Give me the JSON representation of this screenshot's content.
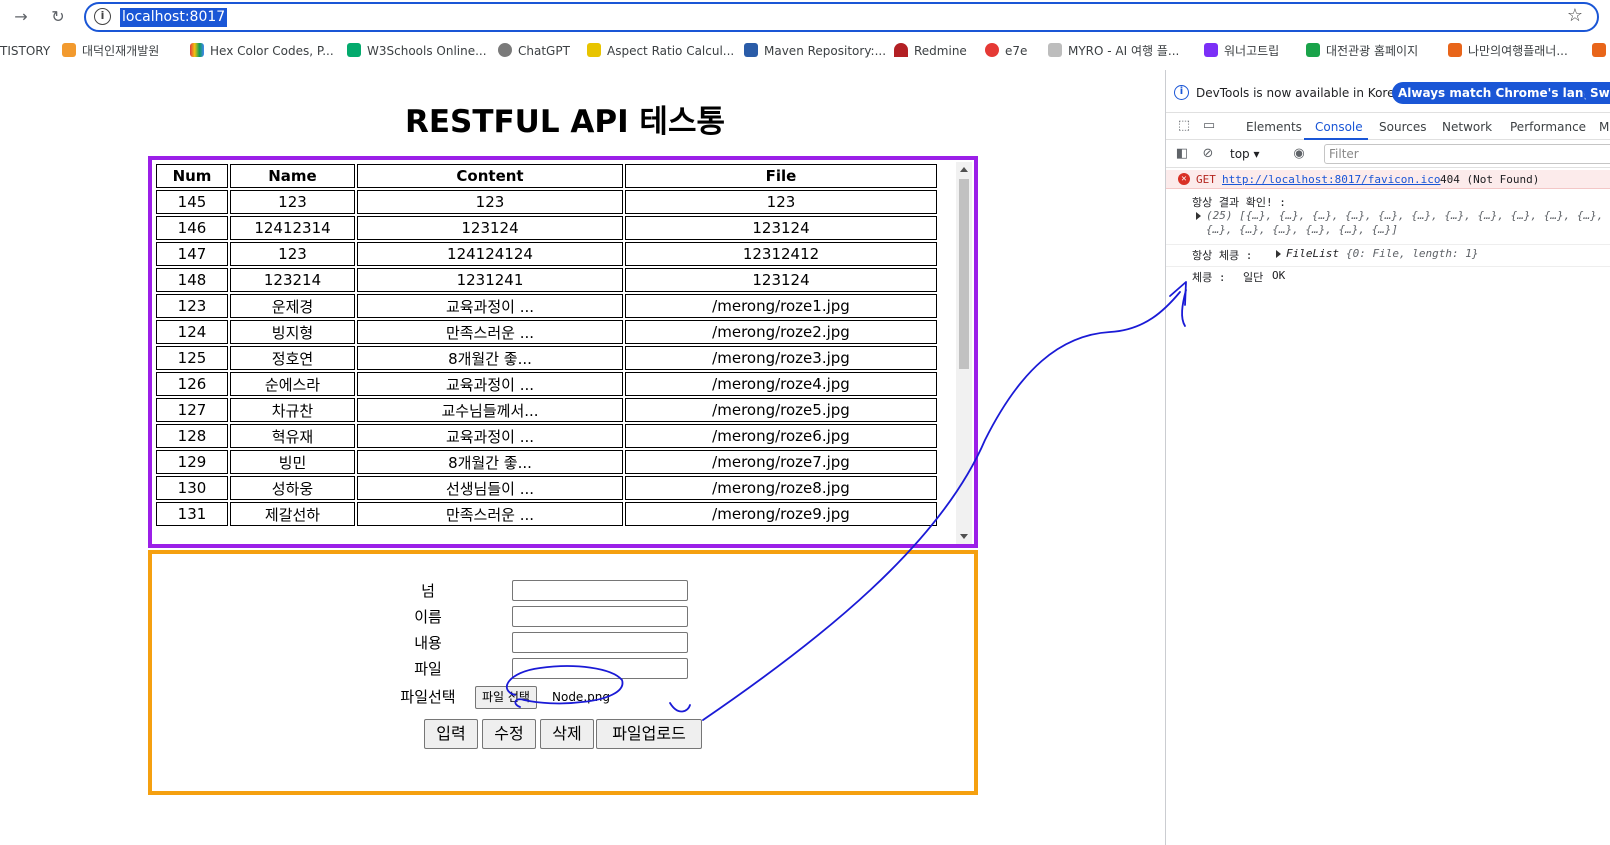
{
  "browser": {
    "url": "localhost:8017",
    "bookmarks": [
      {
        "label": "TISTORY",
        "color": "#000000"
      },
      {
        "label": "대덕인재개발원",
        "color": "#f29a2e"
      },
      {
        "label": "Hex Color Codes, P...",
        "color": "#e03a3e"
      },
      {
        "label": "W3Schools Online...",
        "color": "#04aa6d"
      },
      {
        "label": "ChatGPT",
        "color": "#7a7a7a"
      },
      {
        "label": "Aspect Ratio Calcul...",
        "color": "#e8c400"
      },
      {
        "label": "Maven Repository:...",
        "color": "#2a5ca8"
      },
      {
        "label": "Redmine",
        "color": "#b32024"
      },
      {
        "label": "e7e",
        "color": "#e53935"
      },
      {
        "label": "MYRO - AI 여행 플...",
        "color": "#bdbdbd"
      },
      {
        "label": "워너고트립",
        "color": "#7b2ff7"
      },
      {
        "label": "대전관광 홈페이지",
        "color": "#1aa34a"
      },
      {
        "label": "나만의여행플래너...",
        "color": "#e8651a"
      }
    ]
  },
  "page": {
    "title": "RESTFUL API 테스통",
    "table": {
      "headers": [
        "Num",
        "Name",
        "Content",
        "File"
      ],
      "rows": [
        [
          "145",
          "123",
          "123",
          "123"
        ],
        [
          "146",
          "12412314",
          "123124",
          "123124"
        ],
        [
          "147",
          "123",
          "124124124",
          "12312412"
        ],
        [
          "148",
          "123214",
          "1231241",
          "123124"
        ],
        [
          "123",
          "운제경",
          "교육과정이 ...",
          "/merong/roze1.jpg"
        ],
        [
          "124",
          "빙지형",
          "만족스러운 ...",
          "/merong/roze2.jpg"
        ],
        [
          "125",
          "정호연",
          "8개월간 좋...",
          "/merong/roze3.jpg"
        ],
        [
          "126",
          "순에스라",
          "교육과정이 ...",
          "/merong/roze4.jpg"
        ],
        [
          "127",
          "차규찬",
          "교수님들께서...",
          "/merong/roze5.jpg"
        ],
        [
          "128",
          "혁유재",
          "교육과정이 ...",
          "/merong/roze6.jpg"
        ],
        [
          "129",
          "빙민",
          "8개월간 좋...",
          "/merong/roze7.jpg"
        ],
        [
          "130",
          "성하웅",
          "선생님들이 ...",
          "/merong/roze8.jpg"
        ],
        [
          "131",
          "제갈선하",
          "만족스러운 ...",
          "/merong/roze9.jpg"
        ]
      ]
    },
    "form": {
      "labels": {
        "num": "넘",
        "name": "이름",
        "content": "내용",
        "file": "파일",
        "file_select": "파일선택"
      },
      "file_button": "파일 선택",
      "chosen_file": "Node.png",
      "buttons": {
        "insert": "입력",
        "update": "수정",
        "delete": "삭제",
        "upload": "파일업로드"
      }
    }
  },
  "devtools": {
    "notice": "DevTools is now available in Korean!",
    "match_button": "Always match Chrome's language",
    "switch_button": "Swit",
    "tabs": [
      "Elements",
      "Console",
      "Sources",
      "Network",
      "Performance",
      "M"
    ],
    "active_tab": "Console",
    "context": "top",
    "filter_placeholder": "Filter",
    "console": {
      "error_method": "GET",
      "error_url": "http://localhost:8017/favicon.ico",
      "error_status": "404 (Not Found)",
      "log1_label": "항상 결과 확인! :",
      "log1_summary1": "(25) [{…}, {…}, {…}, {…}, {…}, {…}, {…}, {…}, {…}, {…}, {…},",
      "log1_summary2": "{…}, {…}, {…}, {…}, {…}, {…}]",
      "log2_label": "항상 체킁 :",
      "log2_value_name": "FileList",
      "log2_value_detail": "{0: File, length: 1}",
      "log3_label": "체킁 :",
      "log3_value1": "일단",
      "log3_value2": "OK"
    }
  },
  "annotation_color": "#1a1ad6"
}
